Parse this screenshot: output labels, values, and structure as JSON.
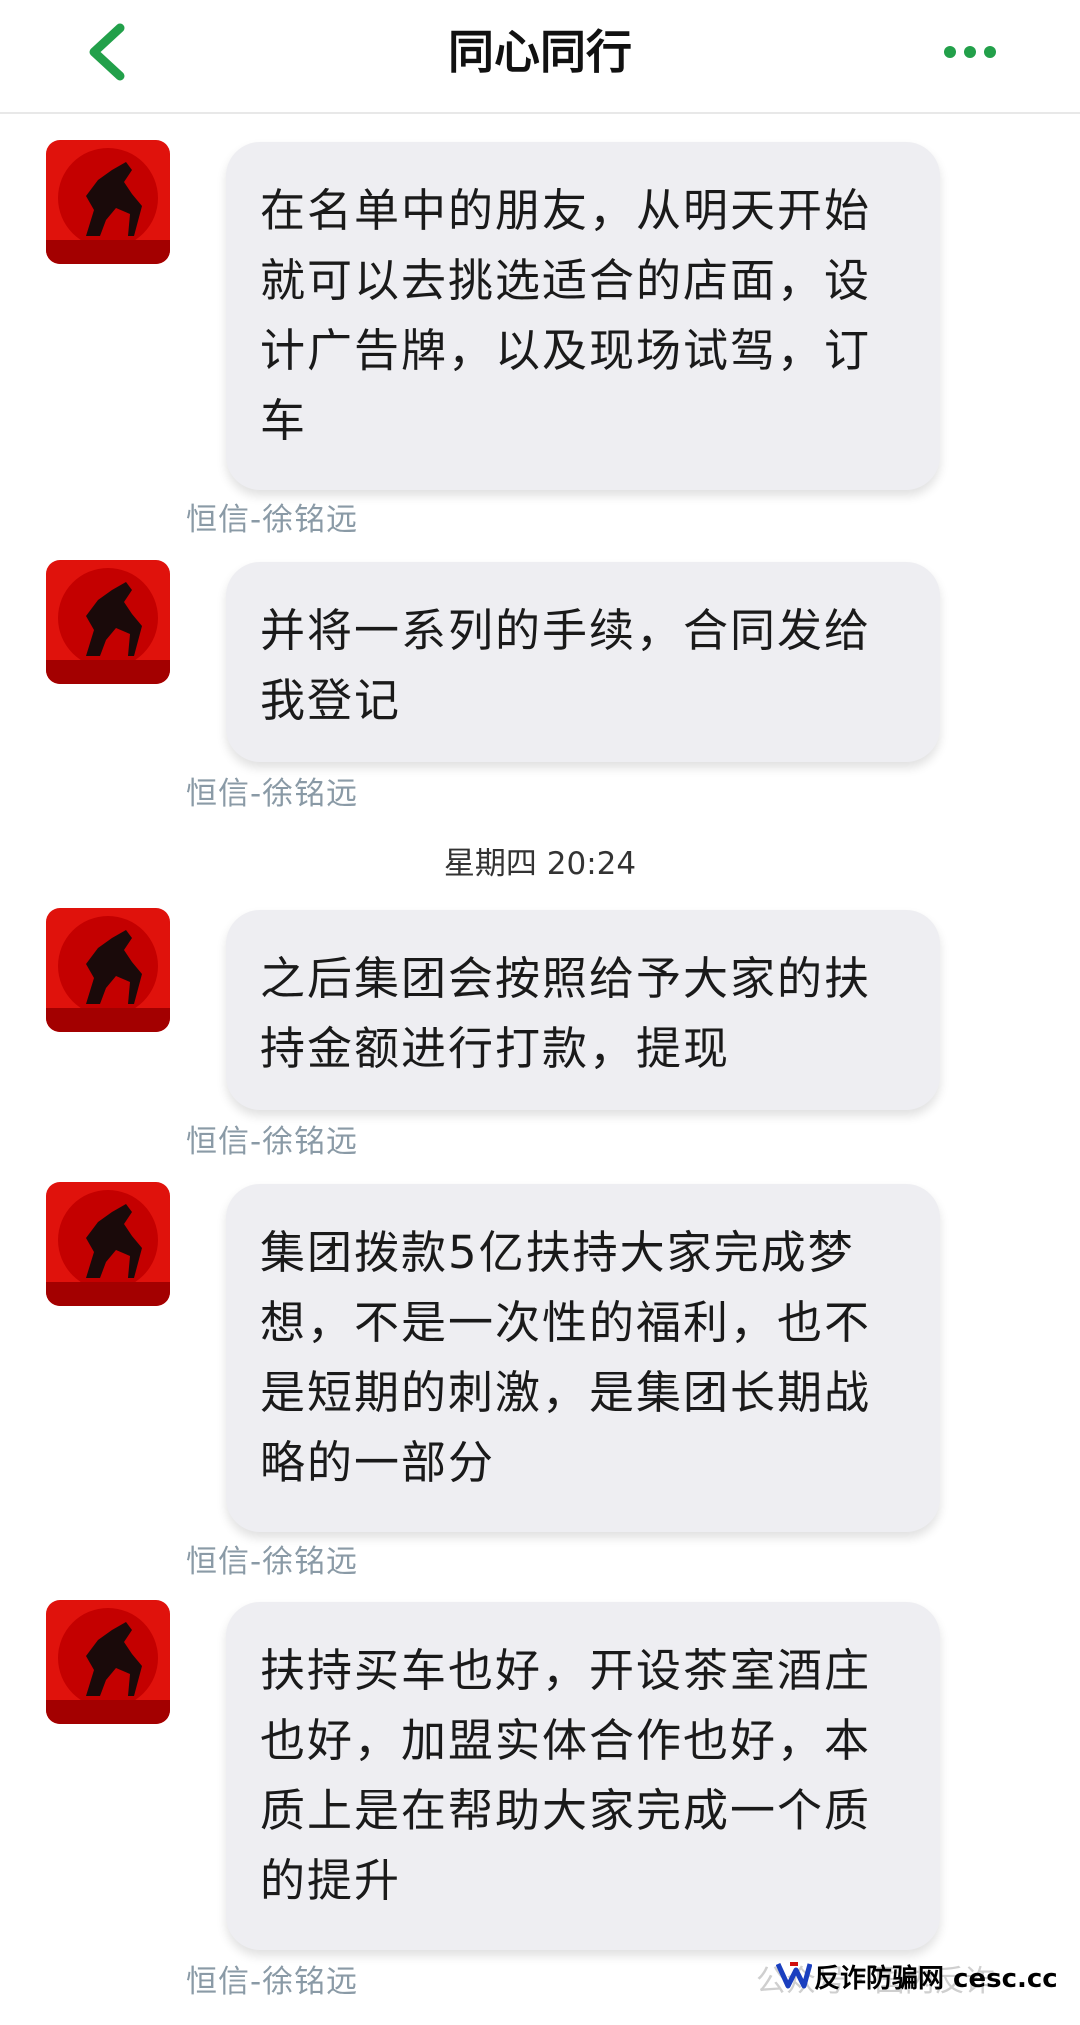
{
  "header": {
    "title": "同心同行",
    "back_icon": "chevron-left-icon",
    "more_icon": "more-dots-icon",
    "accent_color": "#22a04a"
  },
  "messages": [
    {
      "text": "在名单中的朋友，从明天开始就可以去挑选适合的店面，设计广告牌，以及现场试驾，订车",
      "sender": "恒信-徐铭远"
    },
    {
      "text": "并将一系列的手续，合同发给我登记",
      "sender": "恒信-徐铭远"
    },
    {
      "text": "之后集团会按照给予大家的扶持金额进行打款，提现",
      "sender": "恒信-徐铭远"
    },
    {
      "text": "集团拨款5亿扶持大家完成梦想，不是一次性的福利，也不是短期的刺激，是集团长期战略的一部分",
      "sender": "恒信-徐铭远"
    },
    {
      "text": "扶持买车也好，开设茶室酒庄也好，加盟实体合作也好，本质上是在帮助大家完成一个质的提升",
      "sender": "恒信-徐铭远"
    }
  ],
  "timestamp": "星期四 20:24",
  "watermark": {
    "text": "反诈防骗网 cesc.cc",
    "faint_text": "公众号 · 国内反诈"
  }
}
